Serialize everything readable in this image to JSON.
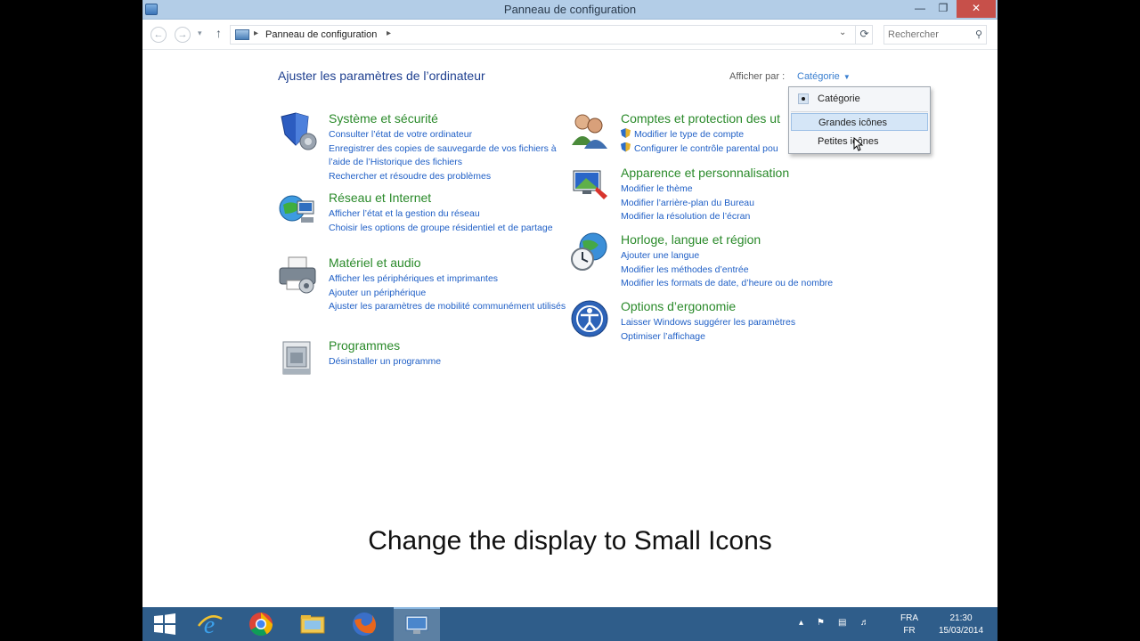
{
  "window": {
    "title": "Panneau de configuration"
  },
  "address": {
    "breadcrumb": "Panneau de configuration",
    "search_placeholder": "Rechercher"
  },
  "main": {
    "title": "Ajuster les paramètres de l’ordinateur",
    "view_by_label": "Afficher par :",
    "view_by_value": "Catégorie"
  },
  "categories": [
    {
      "title": "Système et sécurité",
      "icon": "shield-icon",
      "links": [
        "Consulter l’état de votre ordinateur",
        "Enregistrer des copies de sauvegarde de vos fichiers à l’aide de l’Historique des fichiers",
        "Rechercher et résoudre des problèmes"
      ]
    },
    {
      "title": "Réseau et Internet",
      "icon": "network-icon",
      "links": [
        "Afficher l’état et la gestion du réseau",
        "Choisir les options de groupe résidentiel et de partage"
      ]
    },
    {
      "title": "Matériel et audio",
      "icon": "printer-icon",
      "links": [
        "Afficher les périphériques et imprimantes",
        "Ajouter un périphérique",
        "Ajuster les paramètres de mobilité communément utilisés"
      ]
    },
    {
      "title": "Programmes",
      "icon": "programs-icon",
      "links": [
        "Désinstaller un programme"
      ]
    },
    {
      "title": "Comptes et protection des ut",
      "icon": "users-icon",
      "links": [
        "Modifier le type de compte",
        "Configurer le contrôle parental pou"
      ]
    },
    {
      "title": "Apparence et personnalisation",
      "icon": "appearance-icon",
      "links": [
        "Modifier le thème",
        "Modifier l’arrière-plan du Bureau",
        "Modifier la résolution de l’écran"
      ]
    },
    {
      "title": "Horloge, langue et région",
      "icon": "clock-globe-icon",
      "links": [
        "Ajouter une langue",
        "Modifier les méthodes d’entrée",
        "Modifier les formats de date, d’heure ou de nombre"
      ]
    },
    {
      "title": "Options d’ergonomie",
      "icon": "ease-of-access-icon",
      "links": [
        "Laisser Windows suggérer les paramètres",
        "Optimiser l’affichage"
      ]
    }
  ],
  "dropdown": {
    "items": [
      "Catégorie",
      "Grandes icônes",
      "Petites icônes"
    ],
    "selected": "Catégorie",
    "hovered": "Grandes icônes"
  },
  "caption": "Change the display to Small Icons",
  "taskbar": {
    "lang_top": "FRA",
    "lang_bottom": "FR",
    "time": "21:30",
    "date": "15/03/2014"
  },
  "colors": {
    "category_title": "#2a8a2a",
    "link": "#1f5fc6",
    "title_blue": "#1e3f8f",
    "taskbar": "#2f5d8a"
  }
}
